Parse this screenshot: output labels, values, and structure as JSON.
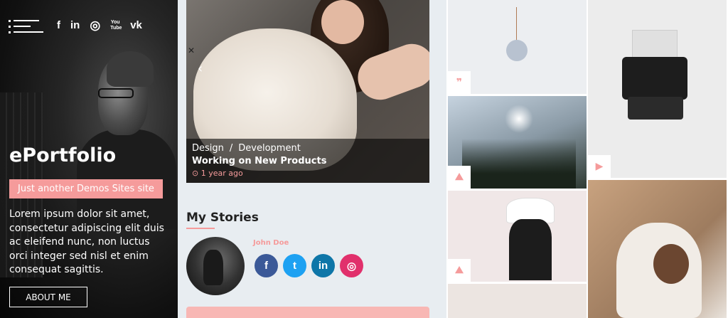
{
  "sidebar": {
    "social_icons": [
      "f",
      "in",
      "◎",
      "You Tube",
      "vk"
    ],
    "site_title": "ePortfolio",
    "tagline": "Just another Demos Sites site",
    "bio": "Lorem ipsum dolor sit amet, consectetur adipiscing elit duis ac eleifend nunc, non luctus orci integer sed nisl et enim consequat sagittis.",
    "about_label": "ABOUT ME"
  },
  "slider": {
    "category_1": "Design",
    "separator": "/",
    "category_2": "Development",
    "post_title": "Working on New Products",
    "post_time": "⊙ 1 year ago",
    "prev_arrow": "‹",
    "edge_arrow": "✕"
  },
  "stories": {
    "title": "My Stories",
    "author_name": "John Doe",
    "social_icons": [
      "f",
      "t",
      "in",
      "◎"
    ],
    "colors": {
      "facebook": "#3b5998",
      "twitter": "#1da1f2",
      "linkedin": "#0e76a8",
      "instagram": "#e1306c"
    }
  },
  "grid": {
    "badges": [
      "❞",
      "⛰",
      "⛰",
      "▶"
    ]
  },
  "colors": {
    "accent": "#f59b9b",
    "background": "#e8edf1"
  }
}
